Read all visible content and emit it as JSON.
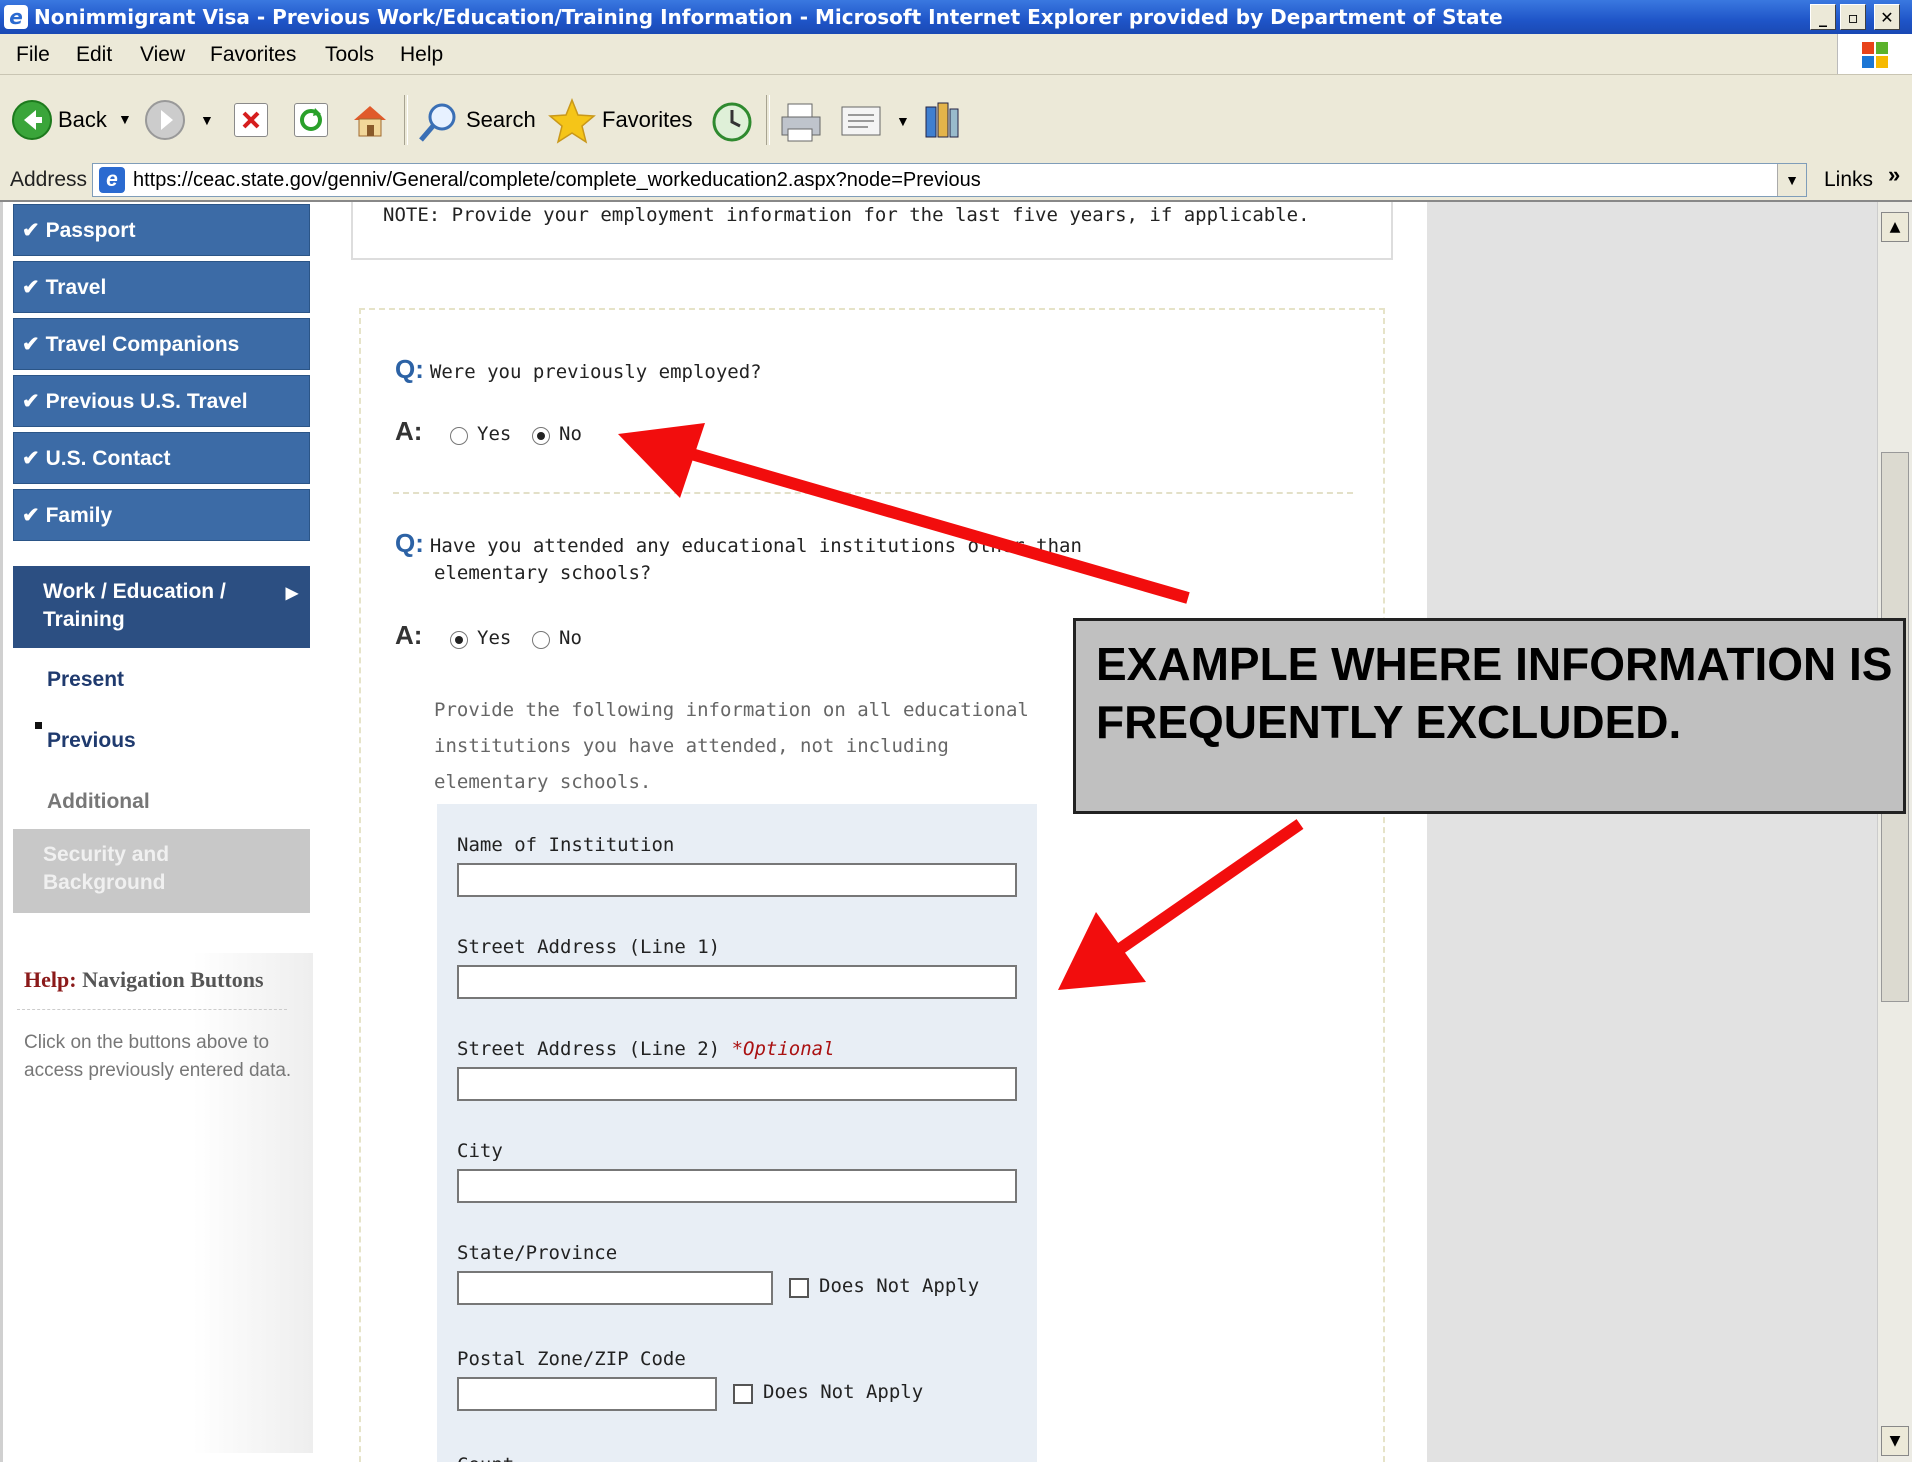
{
  "window": {
    "title": "Nonimmigrant Visa - Previous Work/Education/Training Information - Microsoft Internet Explorer provided by Department of State",
    "minimize": "_",
    "maximize": "▫",
    "close": "✕"
  },
  "menubar": {
    "items": [
      "File",
      "Edit",
      "View",
      "Favorites",
      "Tools",
      "Help"
    ]
  },
  "toolbar": {
    "back_label": "Back",
    "search_label": "Search",
    "favorites_label": "Favorites"
  },
  "address": {
    "label": "Address",
    "url": "https://ceac.state.gov/genniv/General/complete/complete_workeducation2.aspx?node=Previous",
    "links_label": "Links",
    "links_more": "»"
  },
  "sidebar": {
    "completed": [
      "Passport",
      "Travel",
      "Travel Companions",
      "Previous U.S. Travel",
      "U.S. Contact",
      "Family"
    ],
    "active_line1": "Work / Education /",
    "active_line2": "Training",
    "sub_present": "Present",
    "sub_previous": "Previous",
    "sub_additional": "Additional",
    "disabled_line1": "Security and",
    "disabled_line2": "Background",
    "check": "✔",
    "arrow": "▶"
  },
  "help": {
    "prefix": "Help:",
    "title": "Navigation Buttons",
    "text": "Click on the buttons above to access previously entered data."
  },
  "main": {
    "note": "NOTE: Provide your employment information for the last five years, if applicable.",
    "q_marker": "Q:",
    "a_marker": "A:",
    "q1": "Were you previously employed?",
    "q1_selected": "No",
    "q2_line1": "Have you attended any educational institutions other than",
    "q2_line2": "elementary schools?",
    "q2_selected": "Yes",
    "yes": "Yes",
    "no": "No",
    "instructions": "Provide the following information on all educational institutions you have attended, not including elementary schools.",
    "fields": {
      "institution": "Name of Institution",
      "street1": "Street Address (Line 1)",
      "street2": "Street Address (Line 2)",
      "optional": "*Optional",
      "city": "City",
      "state": "State/Province",
      "postal": "Postal Zone/ZIP Code",
      "does_not_apply": "Does Not Apply",
      "country_partial": "Count"
    }
  },
  "callout": {
    "text": "EXAMPLE WHERE INFORMATION IS FREQUENTLY EXCLUDED."
  },
  "colors": {
    "nav_blue": "#3c6ba6",
    "nav_active": "#2c4f82",
    "arrow_red": "#f20d0d",
    "q_blue": "#2c62a5",
    "optional_red": "#a11111"
  }
}
